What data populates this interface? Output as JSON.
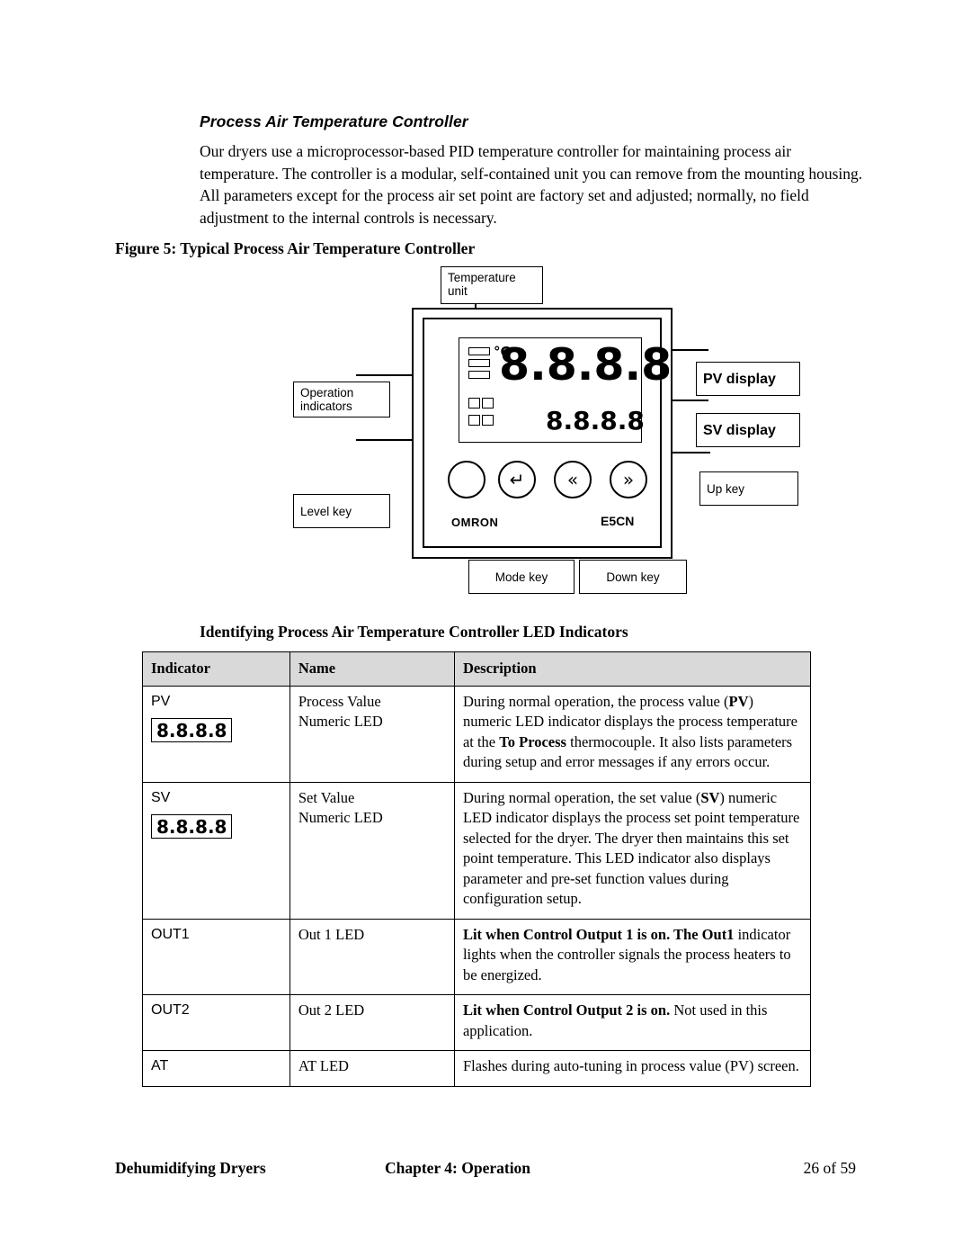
{
  "section": {
    "title": "Process Air Temperature Controller",
    "paragraph": "Our dryers use a microprocessor-based PID temperature controller for maintaining process air temperature. The controller is a modular, self-contained unit you can remove from the mounting housing. All parameters except for the process air set point are factory set and adjusted; normally, no field adjustment to the internal controls is necessary."
  },
  "figure": {
    "label": "Figure 5:",
    "caption": "Typical Process Air Temperature Controller",
    "callouts": {
      "temperature_unit": "Temperature\nunit",
      "operation_indicators": "Operation\nindicators",
      "level_key": "Level key",
      "pv_display": "PV display",
      "sv_display": "SV display",
      "up_key": "Up key",
      "mode_key": "Mode key",
      "down_key": "Down key"
    },
    "device": {
      "brand": "OMRON",
      "model": "E5CN",
      "pv_value": "8.8.8.8",
      "sv_value": "8.8.8.8",
      "unit_symbol": "°C",
      "key_glyphs": {
        "level": "",
        "mode": "↵",
        "down": "«",
        "up": "»"
      }
    }
  },
  "led_section": {
    "heading": "Identifying Process Air Temperature Controller LED Indicators",
    "columns": [
      "Indicator",
      "Name",
      "Description"
    ],
    "rows": [
      {
        "indicator": "PV",
        "indicator_led": "8.8.8.8",
        "name": "Process Value\nNumeric LED",
        "description_parts": [
          {
            "text": "During normal operation, the process value ("
          },
          {
            "text": "PV",
            "bold": true
          },
          {
            "text": ") numeric LED indicator displays the process temperature at the "
          },
          {
            "text": "To Process",
            "bold": true
          },
          {
            "text": " thermocouple. It also lists parameters during setup and error messages if any errors occur."
          }
        ]
      },
      {
        "indicator": "SV",
        "indicator_led": "8.8.8.8",
        "name": "Set Value\nNumeric LED",
        "description_parts": [
          {
            "text": "During normal operation, the set value ("
          },
          {
            "text": "SV",
            "bold": true
          },
          {
            "text": ") numeric LED indicator displays the process set point temperature selected for the dryer. The dryer then maintains this set point temperature.  This LED indicator also displays parameter and pre-set function values during configuration setup."
          }
        ]
      },
      {
        "indicator": "OUT1",
        "indicator_led": "",
        "name": "Out 1 LED",
        "description_parts": [
          {
            "text": "Lit when Control Output 1 is on.  The Out1",
            "bold": true
          },
          {
            "text": " indicator lights when the controller signals the process heaters to be energized."
          }
        ]
      },
      {
        "indicator": "OUT2",
        "indicator_led": "",
        "name": "Out 2 LED",
        "description_parts": [
          {
            "text": "Lit when Control Output 2 is on.",
            "bold": true
          },
          {
            "text": " Not used in this application."
          }
        ]
      },
      {
        "indicator": "AT",
        "indicator_led": "",
        "name": "AT LED",
        "description_parts": [
          {
            "text": "Flashes during auto-tuning in process value (PV) screen."
          }
        ]
      }
    ]
  },
  "footer": {
    "left": "Dehumidifying Dryers",
    "center_chapter": "Chapter 4",
    "center_rest": ": Operation",
    "right": "26 of 59"
  }
}
